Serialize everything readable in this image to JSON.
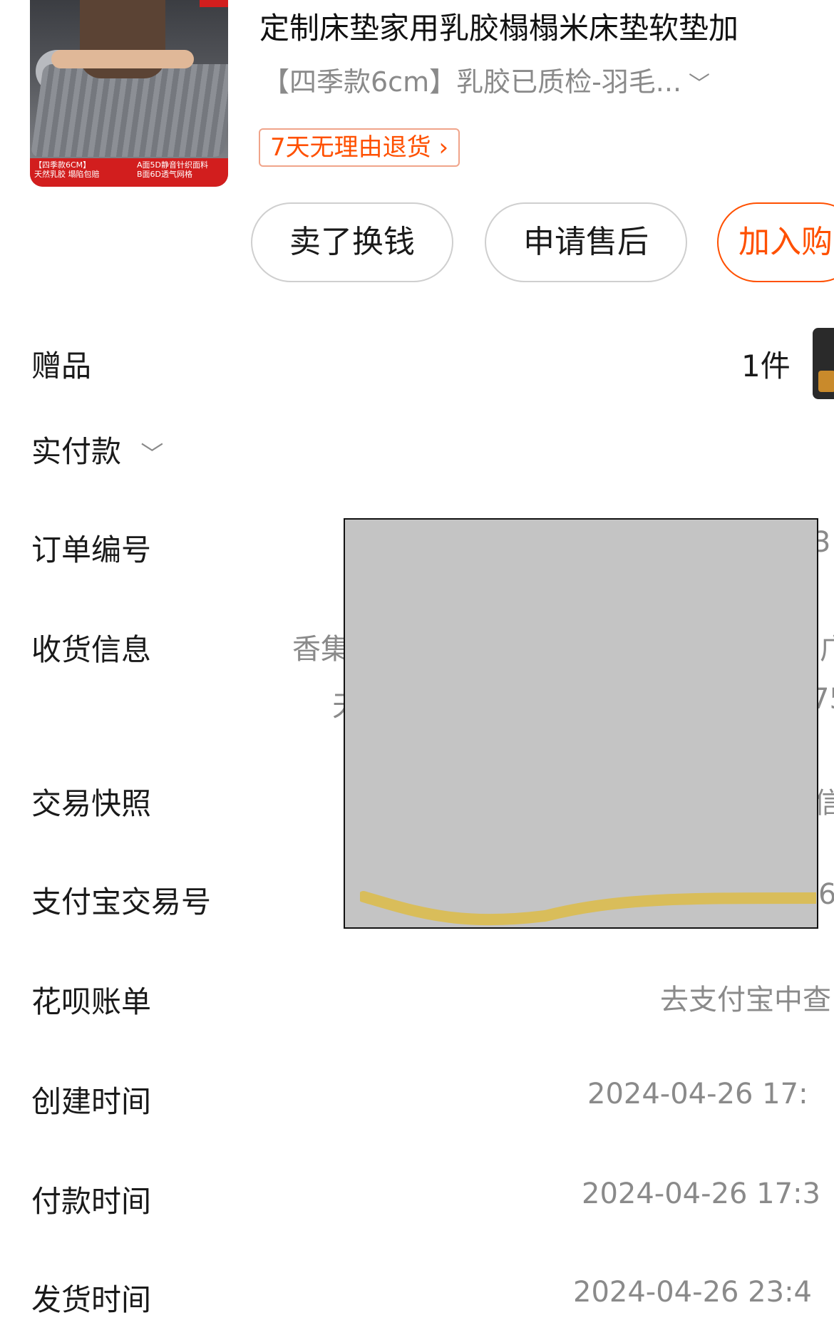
{
  "product": {
    "title": "定制床垫家用乳胶榻榻米床垫软垫加",
    "sku": "【四季款6cm】乳胶已质检-羽毛...",
    "return_policy": "7天无理由退货 ›",
    "image_banner_left": "【四季款6CM】\n天然乳胶 塌陷包赔",
    "image_banner_right": "A面5D静音针织面料\nB面6D透气网格"
  },
  "actions": {
    "sell": "卖了换钱",
    "after_sale": "申请售后",
    "add_cart": "加入购"
  },
  "rows": {
    "gift_label": "赠品",
    "gift_count": "1件",
    "paid_label": "实付款",
    "order_no_label": "订单编号",
    "shipping_label": "收货信息",
    "shipping_value_start": "香集",
    "shipping_value_end": "广",
    "shipping_line2_start": "天",
    "shipping_line2_end": "75",
    "snapshot_label": "交易快照",
    "snapshot_value_end": "信",
    "order_no_value_end": "3",
    "alipay_label": "支付宝交易号",
    "alipay_value_end": "6",
    "huabei_label": "花呗账单",
    "huabei_value": "去支付宝中查",
    "created_label": "创建时间",
    "created_value": "2024-04-26 17:",
    "paid_time_label": "付款时间",
    "paid_time_value": "2024-04-26 17:3",
    "ship_time_label": "发货时间",
    "ship_time_value": "2024-04-26 23:4"
  },
  "colors": {
    "accent": "#ff5000",
    "muted_text": "#8a8a8a",
    "redaction": "#c4c4c4",
    "scribble": "#d9bd5a"
  }
}
